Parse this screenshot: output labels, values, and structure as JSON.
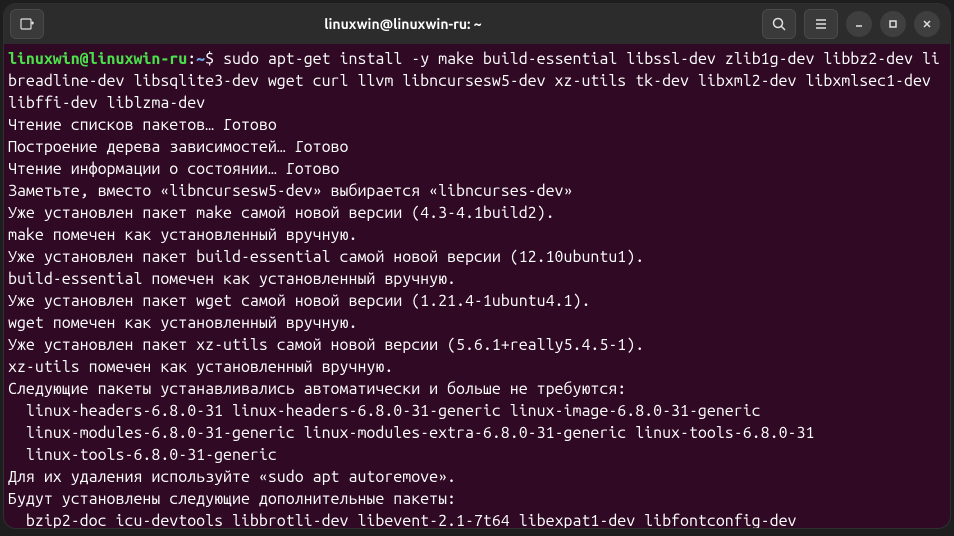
{
  "window": {
    "title": "linuxwin@linuxwin-ru: ~"
  },
  "prompt": {
    "user_host": "linuxwin@linuxwin-ru",
    "colon": ":",
    "path": "~",
    "sigil": "$"
  },
  "command": "sudo apt-get install -y make build-essential libssl-dev zlib1g-dev libbz2-dev libreadline-dev libsqlite3-dev wget curl llvm libncursesw5-dev xz-utils tk-dev libxml2-dev libxmlsec1-dev libffi-dev liblzma-dev",
  "output_lines": [
    "Чтение списков пакетов… Готово",
    "Построение дерева зависимостей… Готово",
    "Чтение информации о состоянии… Готово",
    "Заметьте, вместо «libncursesw5-dev» выбирается «libncurses-dev»",
    "Уже установлен пакет make самой новой версии (4.3-4.1build2).",
    "make помечен как установленный вручную.",
    "Уже установлен пакет build-essential самой новой версии (12.10ubuntu1).",
    "build-essential помечен как установленный вручную.",
    "Уже установлен пакет wget самой новой версии (1.21.4-1ubuntu4.1).",
    "wget помечен как установленный вручную.",
    "Уже установлен пакет xz-utils самой новой версии (5.6.1+really5.4.5-1).",
    "xz-utils помечен как установленный вручную.",
    "Следующие пакеты устанавливались автоматически и больше не требуются:",
    "  linux-headers-6.8.0-31 linux-headers-6.8.0-31-generic linux-image-6.8.0-31-generic",
    "  linux-modules-6.8.0-31-generic linux-modules-extra-6.8.0-31-generic linux-tools-6.8.0-31",
    "  linux-tools-6.8.0-31-generic",
    "Для их удаления используйте «sudo apt autoremove».",
    "Будут установлены следующие дополнительные пакеты:",
    "  bzip2-doc icu-devtools libbrotli-dev libevent-2.1-7t64 libexpat1-dev libfontconfig-dev"
  ]
}
